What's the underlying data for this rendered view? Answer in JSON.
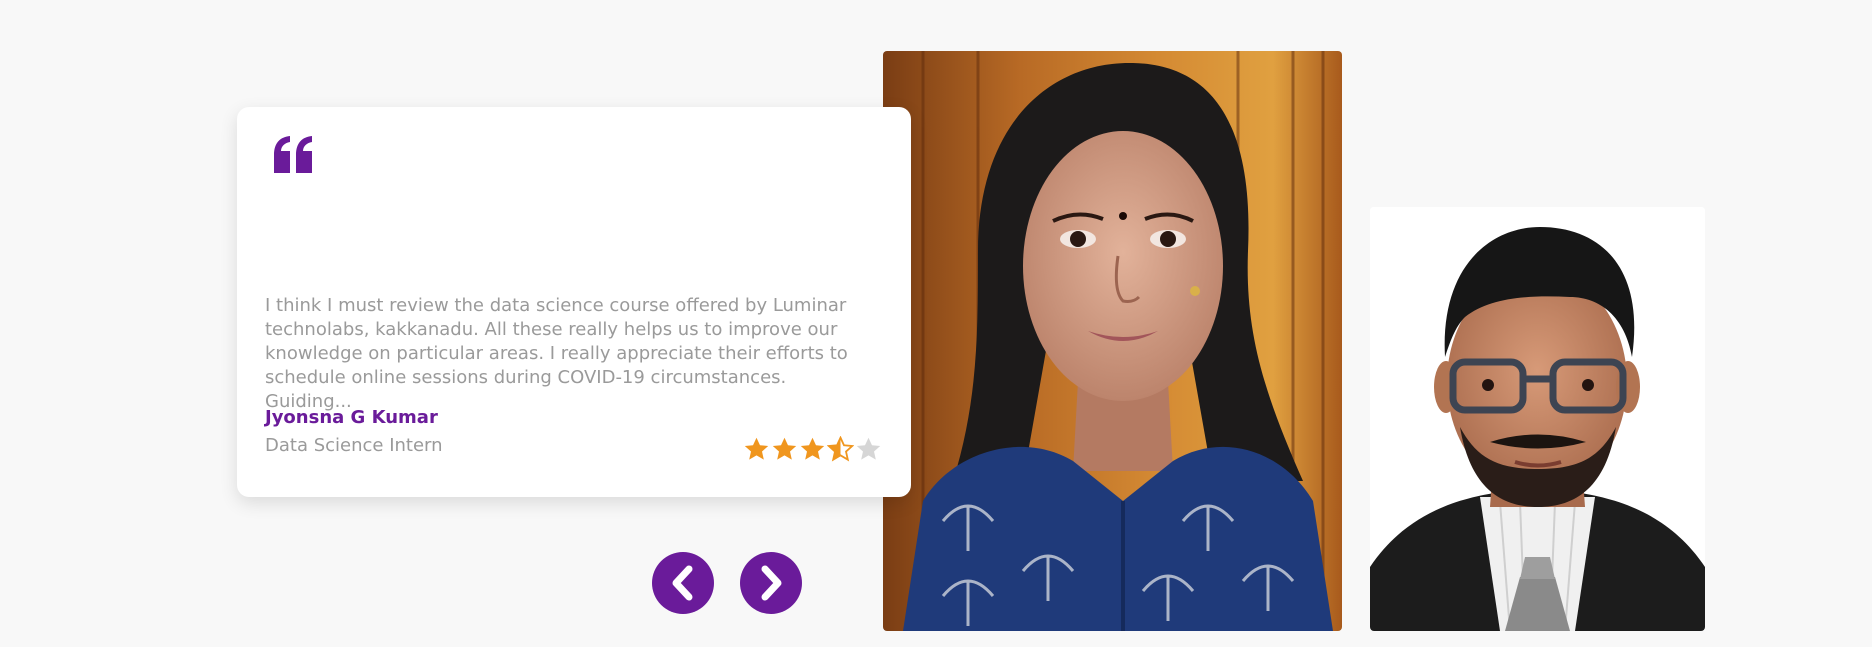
{
  "testimonial": {
    "quote_icon": "quote-icon",
    "text": "I think I must review the data science course offered by Luminar technolabs, kakkanadu. All these really helps us to improve our knowledge on particular areas. I really appreciate their efforts to schedule online sessions during COVID-19 circumstances. Guiding...",
    "name": "Jyonsna G Kumar",
    "role": "Data Science Intern",
    "rating": 3.5,
    "rating_max": 5
  },
  "navigation": {
    "prev_icon": "chevron-left-icon",
    "next_icon": "chevron-right-icon"
  },
  "colors": {
    "accent": "#6a1b9a",
    "star": "#f0961e",
    "star_empty": "#d6d6d6",
    "text_muted": "#9a9a9a",
    "background": "#f8f8f8"
  }
}
